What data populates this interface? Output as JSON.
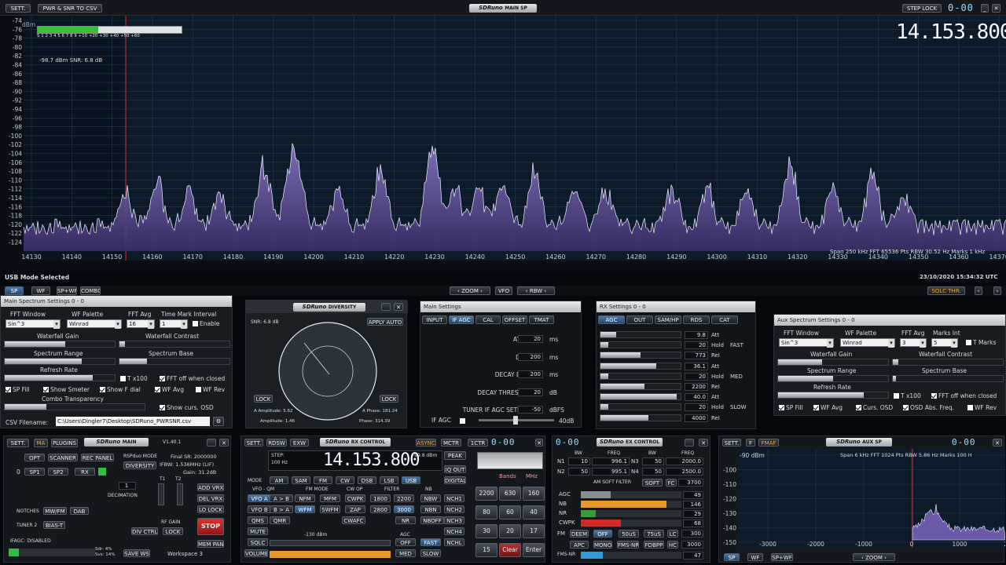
{
  "main_sp": {
    "sett": "SETT.",
    "pwr_btn": "PWR & SNR TO CSV",
    "logo": "SDRuno",
    "logo_sub": "MAIN SP",
    "step_lock": "STEP LOCK",
    "vfo_digits": "0-00",
    "frequency": "14.153.800",
    "dbm_unit": "dBm",
    "smeter_scale": "S  1  2  3  4  5  6  7  8  9  +10 +20 +30 +40 +50 +60",
    "smeter_level": 0.42,
    "readout": "-98.7 dBm   SNR: 6.8 dB",
    "y_ticks": [
      "-74",
      "-76",
      "-78",
      "-80",
      "-82",
      "-84",
      "-86",
      "-88",
      "-90",
      "-92",
      "-94",
      "-96",
      "-98",
      "-100",
      "-102",
      "-104",
      "-106",
      "-108",
      "-110",
      "-112",
      "-114",
      "-116",
      "-118",
      "-120",
      "-122",
      "-124"
    ],
    "x_ticks": [
      "14130",
      "14140",
      "14150",
      "14160",
      "14170",
      "14180",
      "14190",
      "14200",
      "14210",
      "14220",
      "14230",
      "14240",
      "14250",
      "14260",
      "14270",
      "14280",
      "14290",
      "14300",
      "14310",
      "14320",
      "14330",
      "14340",
      "14350",
      "14360",
      "14370"
    ],
    "span_info": "Span 250 kHz  FFT 65536 Pts  RBW 30.52 Hz  Marks 1 kHz",
    "mode_status": "USB Mode Selected",
    "datetime": "23/10/2020 15:34:32 UTC",
    "tabs": [
      "SP",
      "WF",
      "SP+WF",
      "COMBO"
    ],
    "zoom": "ZOOM",
    "vfo": "VFO",
    "rbw": "RBW",
    "sqlc_thr": "SQLC THR."
  },
  "main_sp_settings": {
    "title": "Main Spectrum Settings 0 - 0",
    "fft_window_label": "FFT Window",
    "fft_window": "Sin^3",
    "wf_palette_label": "WF Palette",
    "wf_palette": "Winrad",
    "fft_avg_label": "FFT Avg",
    "fft_avg": "16",
    "tmi_label": "Time Mark Interval",
    "tmi": "1",
    "enable": "Enable",
    "wf_gain": "Waterfall Gain",
    "wf_contrast": "Waterfall Contrast",
    "sp_range": "Spectrum Range",
    "sp_base": "Spectrum Base",
    "refresh": "Refresh Rate",
    "tx100": "T x100",
    "fft_off": "FFT off when closed",
    "sp_fill": "SP Fill",
    "show_smeter": "Show Smeter",
    "show_fdial": "Show F dial",
    "wf_avg": "WF Avg",
    "wf_rev": "WF Rev",
    "combo_trans": "Combo Transparency",
    "show_curs": "Show curs. OSD",
    "csv_label": "CSV Filename:",
    "csv_path": "C:\\Users\\Dingler7\\Desktop\\SDRuno_PWRSNR.csv"
  },
  "diversity": {
    "title": "SDRuno",
    "sub": "DIVERSITY",
    "snr": "SNR: 6.8 dB",
    "apply": "APPLY AUTO",
    "lock": "LOCK",
    "a_amp": "A Amplitude: 5.62",
    "a_phase": "A Phase: 181.24",
    "amp": "Amplitude: 1.46",
    "phase": "Phase: 314.39"
  },
  "main_settings": {
    "title": "Main Settings",
    "tabs": [
      "INPUT",
      "IF AGC",
      "CAL",
      "OFFSET",
      "TMAT"
    ],
    "rows": [
      {
        "label": "ATTACK",
        "value": "20",
        "unit": "ms"
      },
      {
        "label": "DECAY",
        "value": "200",
        "unit": "ms"
      },
      {
        "label": "DECAY DELAY",
        "value": "200",
        "unit": "ms"
      },
      {
        "label": "DECAY THRESHOLD",
        "value": "20",
        "unit": "dB"
      },
      {
        "label": "TUNER IF AGC SETPOINT",
        "value": "-50",
        "unit": "dBFS"
      }
    ],
    "if_agc": "IF AGC",
    "db40": "40dB"
  },
  "rx_settings": {
    "title": "RX Settings 0 - 0",
    "tabs": [
      "AGC",
      "OUT",
      "SAM/HP",
      "RDS",
      "CAT"
    ],
    "rows": [
      {
        "val": "9.8",
        "lab": "Att",
        "mode": ""
      },
      {
        "val": "20",
        "lab": "Hold",
        "mode": "FAST"
      },
      {
        "val": "773",
        "lab": "Rel",
        "mode": ""
      },
      {
        "val": "36.1",
        "lab": "Att",
        "mode": ""
      },
      {
        "val": "20",
        "lab": "Hold",
        "mode": "MED"
      },
      {
        "val": "2200",
        "lab": "Rel",
        "mode": ""
      },
      {
        "val": "40.0",
        "lab": "Att",
        "mode": ""
      },
      {
        "val": "20",
        "lab": "Hold",
        "mode": "SLOW"
      },
      {
        "val": "4000",
        "lab": "Rel",
        "mode": ""
      }
    ],
    "fills": [
      0.2,
      0.1,
      0.5,
      0.7,
      0.1,
      0.55,
      0.95,
      0.1,
      0.6
    ]
  },
  "aux_sp_settings": {
    "title": "Aux Spectrum Settings 0 - 0",
    "fft_window_label": "FFT Window",
    "fft_window": "Sin^3",
    "wf_palette_label": "WF Palette",
    "wf_palette": "Winrad",
    "fft_avg_label": "FFT Avg",
    "fft_avg": "3",
    "marks_label": "Marks Int",
    "marks": "5",
    "t_marks": "T Marks",
    "wf_gain": "Waterfall Gain",
    "wf_contrast": "Waterfall Contrast",
    "sp_range": "Spectrum Range",
    "sp_base": "Spectrum Base",
    "refresh": "Refresh Rate",
    "tx100": "T x100",
    "fft_off": "FFT off when closed",
    "sp_fill": "SP Fill",
    "wf_avg": "WF Avg",
    "curs_osd": "Curs. OSD",
    "osd_abs": "OSD Abs. Freq.",
    "wf_rev": "WF Rev"
  },
  "main_panel": {
    "sett": "SETT.",
    "ma": "MA",
    "plugins": "PLUGINS",
    "logo": "SDRuno",
    "sub": "MAIN",
    "version": "V1.40.1",
    "opt": "OPT",
    "scanner": "SCANNER",
    "rec_panel": "REC PANEL",
    "rsp_mode": "RSPduo MODE",
    "diversity": "DIVERSITY",
    "sp1": "SP1",
    "sp2": "SP2",
    "rx": "RX",
    "zero": "0",
    "final_sr": "Final SR: 2000000",
    "ifbw": "IFBW: 1.536MHz (LIF)",
    "gain": "Gain: 31.2dB",
    "t1": "T1",
    "t2": "T2",
    "dec_val": "1",
    "decimation": "DECIMATION",
    "add_vrx": "ADD VRX",
    "del_vrx": "DEL VRX",
    "lo_lock": "LO LOCK",
    "notches": "NOTCHES",
    "mwfm": "MW/FM",
    "dab": "DAB",
    "tuner2": "TUNER 2",
    "bias_t": "BIAS-T",
    "rf_gain": "RF GAIN",
    "div_ctrl": "DIV CTRL",
    "lock": "LOCK",
    "stop": "STOP",
    "mem_pan": "MEM PAN",
    "ifagc": "IFAGC: DISABLED",
    "sdr": "Sdr: 4%",
    "svs": "Svs: 14%",
    "save_ws": "SAVE WS",
    "workspace": "Workspace 3"
  },
  "rx_control": {
    "sett": "SETT.",
    "rdsw": "RDSW",
    "exw": "EXW",
    "logo": "SDRuno",
    "sub": "RX CONTROL",
    "async": "ASYNC",
    "mctr": "MCTR",
    "1ctr": "1CTR",
    "digits": "0-00",
    "step": "STEP:",
    "step_val": "100 Hz",
    "freq": "14.153.800",
    "level": "-99.8 dBm",
    "peak": "PEAK",
    "iq_out": "IQ OUT",
    "digital": "DIGITAL",
    "mode": "MODE",
    "vfo_qm": "VFO - QM",
    "fm_mode": "FM MODE",
    "cw_op": "CW OP",
    "filter": "FILTER",
    "nb": "NB",
    "modes": [
      "AM",
      "SAM",
      "FM",
      "CW",
      "DSB",
      "LSB",
      "USB"
    ],
    "vfoa": "VFO A",
    "atob": "A > B",
    "nfm": "NFM",
    "mfm": "MFM",
    "cwpk": "CWPK",
    "f1800": "1800",
    "f2200": "2200",
    "nbw": "NBW",
    "nch1": "NCH1",
    "vfob": "VFO B",
    "btoa": "B > A",
    "wfm": "WFM",
    "swfm": "SWFM",
    "zap": "ZAP",
    "f2800": "2800",
    "f3000": "3000",
    "nbn": "NBN",
    "nch2": "NCH2",
    "qms": "QMS",
    "qmr": "QMR",
    "cwafc": "CWAFC",
    "nr": "NR",
    "nboff": "NBOFF",
    "nch3": "NCH3",
    "mute": "MUTE",
    "db130": "-130 dBm",
    "nch4": "NCH4",
    "sqlc": "SQLC",
    "agc": "AGC",
    "off": "OFF",
    "fast": "FAST",
    "nchl": "NCHL",
    "volume": "VOLUME",
    "med": "MED",
    "slow": "SLOW",
    "bands": "Bands",
    "mhz": "MHz",
    "keypad": [
      "2200",
      "630",
      "160",
      "80",
      "60",
      "40",
      "30",
      "20",
      "17",
      "15",
      "Clear",
      "Enter"
    ]
  },
  "ex_control": {
    "digits": "0-00",
    "logo": "SDRuno",
    "sub": "EX CONTROL",
    "bw": "BW",
    "freq": "FREQ",
    "n1": "N1",
    "n1_bw": "10",
    "n1_freq": "996.1",
    "n3": "N3",
    "n3_bw": "50",
    "n3_freq": "2000.0",
    "n2": "N2",
    "n2_bw": "50",
    "n2_freq": "995.1",
    "n4": "N4",
    "n4_bw": "50",
    "n4_freq": "2500.0",
    "am_soft": "AM SOFT FILTER",
    "soft": "SOFT",
    "fc": "FC",
    "fc_val": "3700",
    "bars": [
      {
        "label": "AGC",
        "val": "49",
        "fill": 0.3,
        "color": "#888e94"
      },
      {
        "label": "NB",
        "val": "146",
        "fill": 0.85,
        "color": "#e89a28"
      },
      {
        "label": "NR",
        "val": "29",
        "fill": 0.15,
        "color": "#3a9a3a"
      },
      {
        "label": "CWPK",
        "val": "68",
        "fill": 0.4,
        "color": "#d02a2a"
      }
    ],
    "fm": "FM",
    "deem": "DEEM",
    "off": "OFF",
    "us50": "50uS",
    "us75": "75uS",
    "lc": "LC",
    "lc_val": "300",
    "apc": "APC",
    "mono": "MONO",
    "fmsnr": "FMS-NR",
    "fdbpp": "FDBPP",
    "hc": "HC",
    "hc_val": "3000",
    "fmsnr_label": "FMS-NR",
    "fmsnr_val": "47"
  },
  "aux_sp": {
    "sett": "SETT.",
    "f": "F",
    "fmaf": "FMAF",
    "logo": "SDRuno",
    "sub": "AUX SP",
    "digits": "0-00",
    "info": "Span 6 kHz   FFT 1024 Pts   RBW 5.86 Hz   Marks 100 H",
    "y_ticks": [
      "-90 dBm",
      "-100",
      "-110",
      "-120",
      "-130",
      "-140",
      "-150"
    ],
    "x_ticks": [
      "-3000",
      "-2000",
      "-1000",
      "0",
      "1000",
      "20"
    ],
    "tabs": [
      "SP",
      "WF",
      "SP+WF"
    ],
    "zoom": "ZOOM"
  }
}
